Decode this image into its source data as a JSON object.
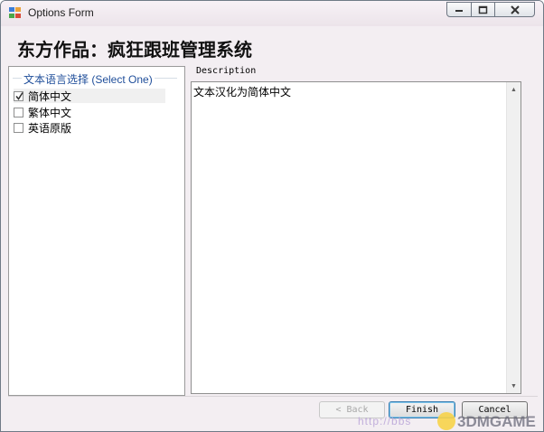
{
  "window": {
    "title": "Options Form",
    "controls": {
      "minimize": "minimize-icon",
      "maximize": "maximize-icon",
      "close": "close-icon"
    }
  },
  "header": {
    "title": "东方作品：疯狂跟班管理系统"
  },
  "language_group": {
    "legend": "文本语言选择 (Select One)",
    "options": [
      {
        "label": "简体中文",
        "checked": true
      },
      {
        "label": "繁体中文",
        "checked": false
      },
      {
        "label": "英语原版",
        "checked": false
      }
    ]
  },
  "description": {
    "label": "Description",
    "text": "文本汉化为简体中文"
  },
  "buttons": {
    "back": "< Back",
    "finish": "Finish",
    "cancel": "Cancel"
  },
  "watermark": {
    "url": "http://bbs",
    "brand": "3DMGAME"
  },
  "colors": {
    "legend": "#1f4e9a",
    "finish_border": "#3c7fb1"
  }
}
